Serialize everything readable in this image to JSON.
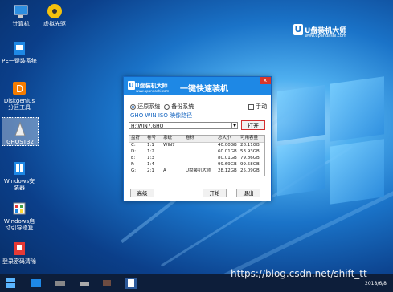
{
  "desktop": {
    "icons": [
      {
        "label": "计算机"
      },
      {
        "label": "虚拟光驱"
      },
      {
        "label": "PE一键装系统"
      },
      {
        "label": "Diskgenius分区工具"
      },
      {
        "label": "GHOST32"
      },
      {
        "label": "Windows安装器"
      },
      {
        "label": "Windows启动引导修复"
      },
      {
        "label": "登录密码清除"
      }
    ],
    "logo": {
      "letter": "U",
      "title": "U盘装机大师",
      "sub": "www.upandashi.com"
    }
  },
  "dialog": {
    "brand_letter": "U",
    "brand_title": "U盘装机大师",
    "brand_sub": "www.upandashi.com",
    "title": "一键快速装机",
    "close_label": "x",
    "radio_restore": "还原系统",
    "radio_backup": "备份系统",
    "manual_label": "手动",
    "link_text": "GHO WIN ISO 映像路径",
    "path_value": "H:\\WIN7.GHO",
    "dropdown_symbol": "▼",
    "open_button": "打开",
    "table": {
      "headers": [
        "盘符",
        "卷号",
        "系统",
        "卷标",
        "总大小",
        "可用容量"
      ],
      "rows": [
        [
          "C:",
          "1:1",
          "WIN7",
          "",
          "40.00GB",
          "28.11GB"
        ],
        [
          "D:",
          "1:2",
          "",
          "",
          "60.01GB",
          "53.93GB"
        ],
        [
          "E:",
          "1:3",
          "",
          "",
          "80.01GB",
          "79.86GB"
        ],
        [
          "F:",
          "1:4",
          "",
          "",
          "99.69GB",
          "99.58GB"
        ],
        [
          "G:",
          "2:1",
          "A",
          "U盘装机大师",
          "28.12GB",
          "25.09GB"
        ]
      ]
    },
    "btn_advanced": "高级",
    "btn_start": "开始",
    "btn_exit": "退出"
  },
  "taskbar": {
    "clock": "2018/6/8"
  },
  "watermark": "https://blog.csdn.net/shift_tt"
}
